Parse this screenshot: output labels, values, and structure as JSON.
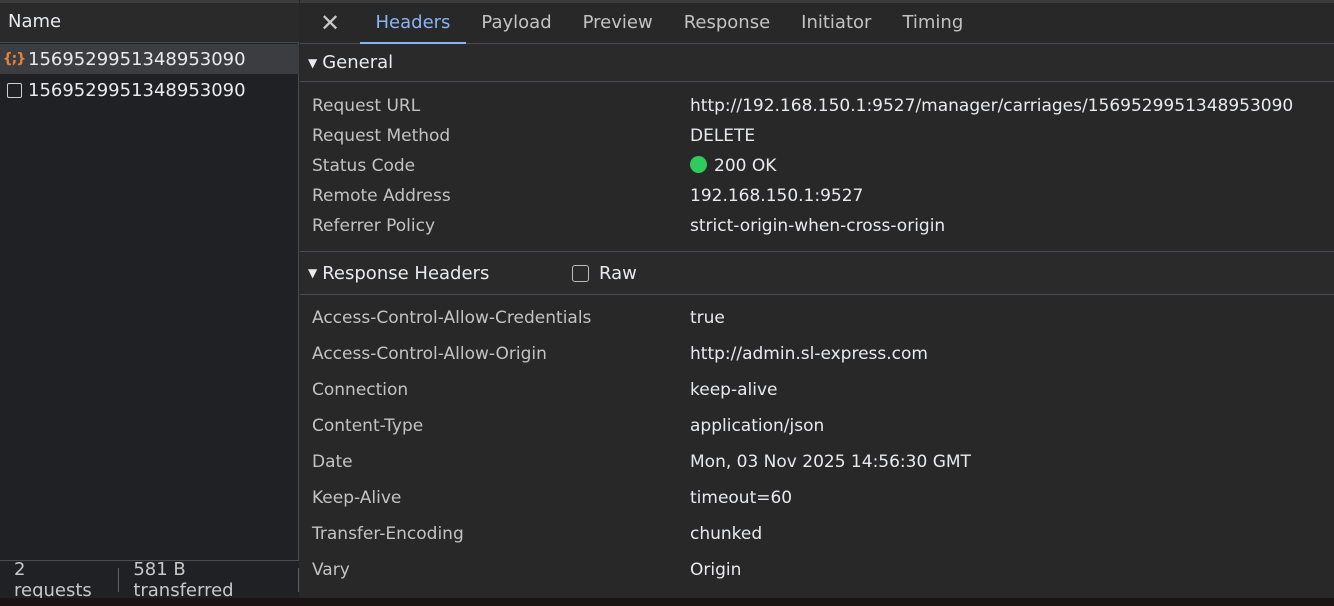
{
  "request_list": {
    "header": "Name",
    "items": [
      {
        "icon": "json-braces-icon",
        "name": "1569529951348953090",
        "selected": true
      },
      {
        "icon": "document-icon",
        "name": "1569529951348953090",
        "selected": false
      }
    ],
    "status": {
      "requests": "2 requests",
      "transferred": "581 B transferred"
    }
  },
  "tabs": [
    {
      "label": "Headers",
      "active": true
    },
    {
      "label": "Payload"
    },
    {
      "label": "Preview"
    },
    {
      "label": "Response"
    },
    {
      "label": "Initiator"
    },
    {
      "label": "Timing"
    }
  ],
  "general": {
    "title": "General",
    "rows": [
      {
        "key": "Request URL",
        "value": "http://192.168.150.1:9527/manager/carriages/1569529951348953090"
      },
      {
        "key": "Request Method",
        "value": "DELETE"
      },
      {
        "key": "Status Code",
        "value": "200 OK",
        "status_color": "#2ecc5b"
      },
      {
        "key": "Remote Address",
        "value": "192.168.150.1:9527"
      },
      {
        "key": "Referrer Policy",
        "value": "strict-origin-when-cross-origin"
      }
    ]
  },
  "response_headers": {
    "title": "Response Headers",
    "raw_label": "Raw",
    "raw_checked": false,
    "rows": [
      {
        "key": "Access-Control-Allow-Credentials",
        "value": "true"
      },
      {
        "key": "Access-Control-Allow-Origin",
        "value": "http://admin.sl-express.com"
      },
      {
        "key": "Connection",
        "value": "keep-alive"
      },
      {
        "key": "Content-Type",
        "value": "application/json"
      },
      {
        "key": "Date",
        "value": "Mon, 03 Nov 2025 14:56:30 GMT"
      },
      {
        "key": "Keep-Alive",
        "value": "timeout=60"
      },
      {
        "key": "Transfer-Encoding",
        "value": "chunked"
      },
      {
        "key": "Vary",
        "value": "Origin"
      }
    ]
  },
  "colors": {
    "accent": "#8ab4f8",
    "status_ok": "#2ecc5b",
    "json_icon": "#e4823a"
  }
}
